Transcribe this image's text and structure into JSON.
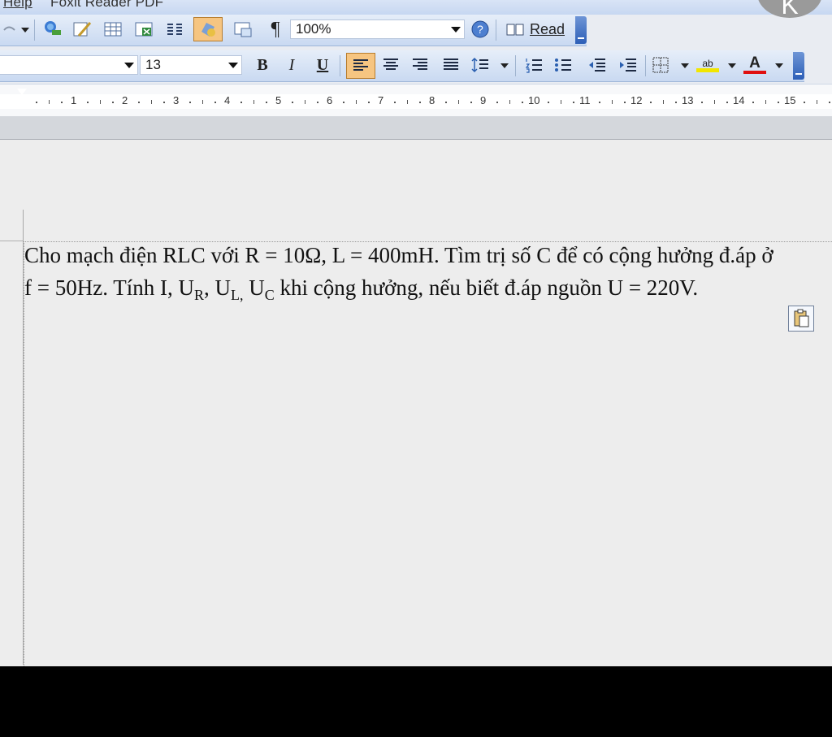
{
  "menu": {
    "help": "Help",
    "foxit": "Foxit Reader PDF"
  },
  "corner_glyph": "K",
  "toolbar_standard": {
    "zoom": "100%",
    "read_label": "Read"
  },
  "toolbar_formatting": {
    "font_size": "13",
    "bold": "B",
    "italic": "I",
    "underline": "U",
    "highlight_label": "ab",
    "font_color_label": "A"
  },
  "ruler": {
    "numbers": [
      "1",
      "2",
      "3",
      "4",
      "5",
      "6",
      "7",
      "8",
      "9",
      "10",
      "11",
      "12",
      "13",
      "14",
      "15"
    ]
  },
  "document": {
    "line1": "Cho mạch điện RLC với R = 10Ω, L = 400mH.  Tìm trị số C để có cộng hưởng đ.áp ở",
    "line2_a": "f = 50Hz.  Tính  I, U",
    "sub_r": "R",
    "comma1": ", U",
    "sub_l": "L,",
    "mid_u": " U",
    "sub_c": "C",
    "line2_b": "  khi cộng hưởng, nếu biết đ.áp nguồn  U = 220V."
  },
  "colors": {
    "highlight": "#f2e600",
    "font_color": "#e01010",
    "active_button": "#f6c581"
  }
}
